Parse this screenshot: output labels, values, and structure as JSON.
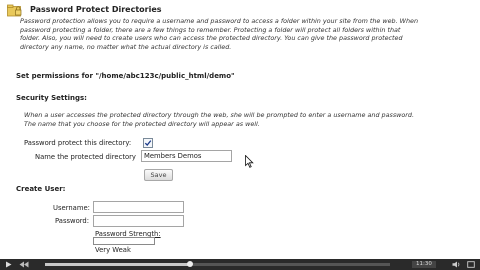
{
  "header": {
    "title": "Password Protect Directories",
    "icon": "lock-folder-icon"
  },
  "intro": {
    "lines": [
      "Password protection allows you to require a username and password to access a folder within your site from the web. When",
      "password protecting a folder, there are a few things to remember. Protecting a folder will protect all folders within that",
      "folder. Also, you will need to create users who can access the protected directory. You can give the password protected",
      "directory any name, no matter what the actual directory is called."
    ]
  },
  "permissions": {
    "heading": "Set permissions for \"/home/abc123c/public_html/demo\""
  },
  "security": {
    "heading": "Security Settings:",
    "note_lines": [
      "When a user accesses the protected directory through the web, she will be prompted to enter a username and password.",
      "The name that you choose for the protected directory will appear as well."
    ],
    "protect_label": "Password protect this directory:",
    "protect_checked": true,
    "name_label": "Name the protected directory",
    "name_value": "Members Demos",
    "save_label": "Save"
  },
  "create_user": {
    "heading": "Create User:",
    "username_label": "Username:",
    "username_value": "",
    "password_label": "Password:",
    "password_value": "",
    "strength_label": "Password Strength:",
    "strength_value": "Very Weak"
  },
  "player": {
    "time": "11:30",
    "progress": 0.42
  },
  "colors": {
    "accent": "#3d7bc4",
    "player_bg": "#2a2a2a"
  }
}
